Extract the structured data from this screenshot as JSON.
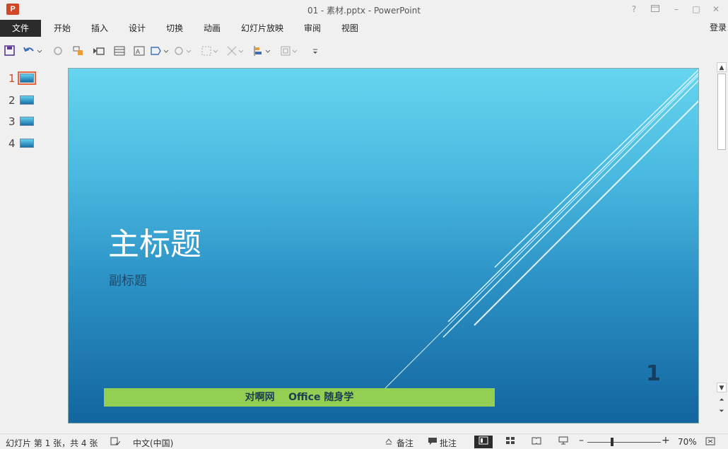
{
  "window": {
    "title": "01 - 素材.pptx - PowerPoint",
    "app_logo": "P",
    "help": "?",
    "minimize": "–",
    "restore": "□",
    "close": "✕"
  },
  "ribbon": {
    "tabs": [
      "文件",
      "开始",
      "插入",
      "设计",
      "切换",
      "动画",
      "幻灯片放映",
      "审阅",
      "视图"
    ],
    "login": "登录"
  },
  "thumbnails": [
    {
      "num": "1",
      "active": true
    },
    {
      "num": "2",
      "active": false
    },
    {
      "num": "3",
      "active": false
    },
    {
      "num": "4",
      "active": false
    }
  ],
  "slide": {
    "title": "主标题",
    "subtitle": "副标题",
    "number": "1",
    "footer_bar": "对啊网    Office 随身学",
    "colors": {
      "top": "#66d5f0",
      "bottom": "#13659f",
      "bar": "#92cf52"
    }
  },
  "statusbar": {
    "slide_info": "幻灯片 第 1 张，共 4 张",
    "language": "中文(中国)",
    "notes": "备注",
    "comments": "批注",
    "zoom": "70%"
  }
}
